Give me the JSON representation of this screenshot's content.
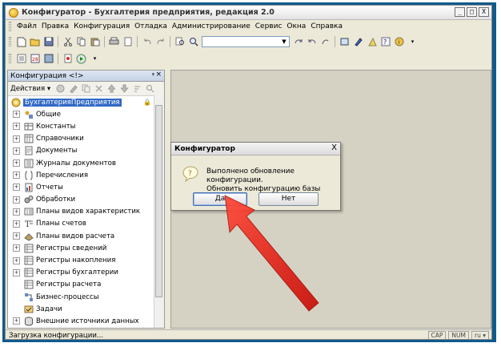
{
  "window": {
    "title": "Конфигуратор - Бухгалтерия предприятия, редакция 2.0",
    "controls": [
      "_",
      "□",
      "X"
    ]
  },
  "menu": [
    "Файл",
    "Правка",
    "Конфигурация",
    "Отладка",
    "Администрирование",
    "Сервис",
    "Окна",
    "Справка"
  ],
  "panel": {
    "title": "Конфигурация  <!>",
    "actions_label": "Действия",
    "root": "БухгалтерияПредприятия",
    "items": [
      {
        "label": "Общие",
        "icon": "shapes-icon",
        "expand": true
      },
      {
        "label": "Константы",
        "icon": "grid-icon",
        "expand": true
      },
      {
        "label": "Справочники",
        "icon": "table-icon",
        "expand": true
      },
      {
        "label": "Документы",
        "icon": "document-icon",
        "expand": true
      },
      {
        "label": "Журналы документов",
        "icon": "journal-icon",
        "expand": true
      },
      {
        "label": "Перечисления",
        "icon": "brackets-icon",
        "expand": true
      },
      {
        "label": "Отчеты",
        "icon": "report-icon",
        "expand": true
      },
      {
        "label": "Обработки",
        "icon": "gears-icon",
        "expand": true
      },
      {
        "label": "Планы видов характеристик",
        "icon": "plan-icon",
        "expand": true
      },
      {
        "label": "Планы счетов",
        "icon": "accounts-icon",
        "expand": true
      },
      {
        "label": "Планы видов расчета",
        "icon": "calc-plan-icon",
        "expand": true
      },
      {
        "label": "Регистры сведений",
        "icon": "register-icon",
        "expand": true
      },
      {
        "label": "Регистры накопления",
        "icon": "register-icon",
        "expand": true
      },
      {
        "label": "Регистры бухгалтерии",
        "icon": "register-icon",
        "expand": true
      },
      {
        "label": "Регистры расчета",
        "icon": "register-icon",
        "expand": false
      },
      {
        "label": "Бизнес-процессы",
        "icon": "process-icon",
        "expand": false
      },
      {
        "label": "Задачи",
        "icon": "task-icon",
        "expand": false
      },
      {
        "label": "Внешние источники данных",
        "icon": "database-icon",
        "expand": true
      }
    ]
  },
  "status": {
    "text": "Загрузка конфигурации...",
    "cap": "CAP",
    "num": "NUM",
    "lang": "ru ▾"
  },
  "dialog": {
    "title": "Конфигуратор",
    "close": "X",
    "line1": "Выполнено обновление конфигурации.",
    "line2": "Обновить конфигурацию базы данных?",
    "yes": "Да",
    "no": "Нет"
  },
  "colors": {
    "frame": "#0f5a8c",
    "selection": "#316ac5",
    "workspace": "#d6d2c3",
    "arrow": "#e0201a"
  }
}
